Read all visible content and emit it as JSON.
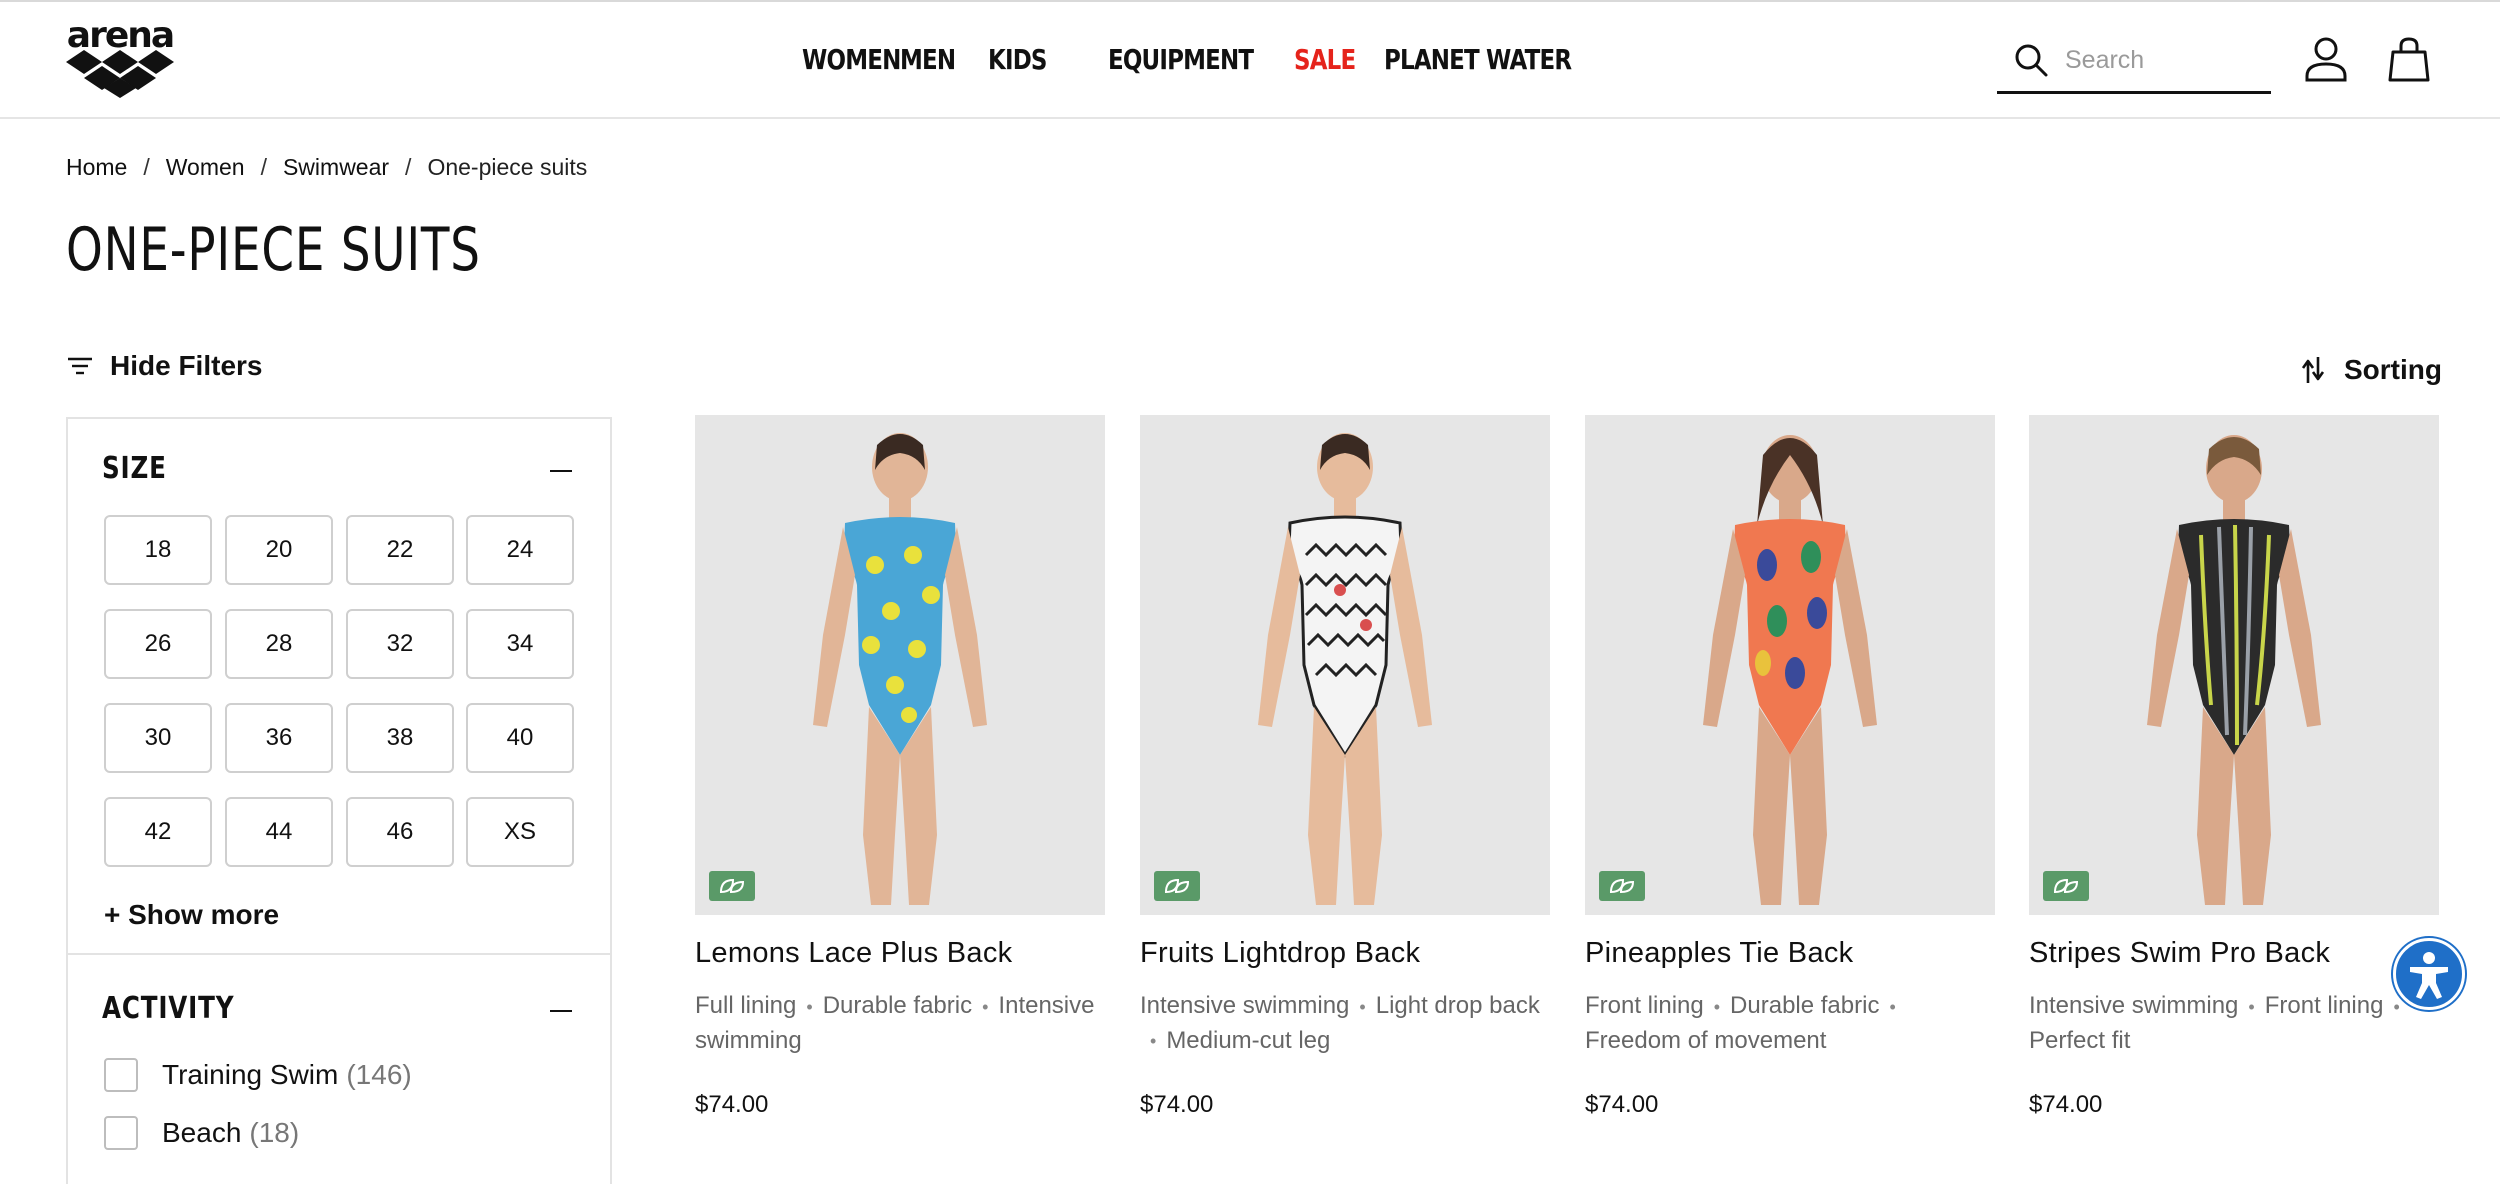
{
  "header": {
    "logo_text": "arena",
    "nav": [
      {
        "label": "WOMEN",
        "highlight": false
      },
      {
        "label": "MEN",
        "highlight": false
      },
      {
        "label": "KIDS",
        "highlight": false
      },
      {
        "label": "EQUIPMENT",
        "highlight": false
      },
      {
        "label": "SALE",
        "highlight": true
      },
      {
        "label": "PLANET WATER",
        "highlight": false
      }
    ],
    "search_placeholder": "Search",
    "search_value": "",
    "icons": {
      "search": "search-icon",
      "account": "user-icon",
      "bag": "shopping-bag-icon"
    }
  },
  "breadcrumb": [
    "Home",
    "Women",
    "Swimwear",
    "One-piece suits"
  ],
  "page_title": "ONE-PIECE SUITS",
  "toolbar": {
    "hide_filters_label": "Hide Filters",
    "sorting_label": "Sorting"
  },
  "filters": {
    "size": {
      "title": "SIZE",
      "options": [
        "18",
        "20",
        "22",
        "24",
        "26",
        "28",
        "32",
        "34",
        "30",
        "36",
        "38",
        "40",
        "42",
        "44",
        "46",
        "XS"
      ],
      "show_more": "+ Show more"
    },
    "activity": {
      "title": "ACTIVITY",
      "options": [
        {
          "label": "Training Swim",
          "count": "(146)"
        },
        {
          "label": "Beach",
          "count": "(18)"
        }
      ]
    }
  },
  "products": [
    {
      "name": "Lemons Lace Plus Back",
      "features": [
        "Full lining",
        "Durable fabric",
        "Intensive swimming"
      ],
      "price": "$74.00",
      "colors": {
        "base": "#4aa6d6",
        "pattern": "#e9e13c",
        "accent": "#3f8f3d"
      }
    },
    {
      "name": "Fruits Lightdrop Back",
      "features": [
        "Intensive swimming",
        "Light drop back",
        "Medium-cut leg"
      ],
      "price": "$74.00",
      "colors": {
        "base": "#f4f4f4",
        "pattern": "#222222",
        "accent": "#d94f4f"
      }
    },
    {
      "name": "Pineapples Tie Back",
      "features": [
        "Front lining",
        "Durable fabric",
        "Freedom of movement"
      ],
      "price": "$74.00",
      "colors": {
        "base": "#f07850",
        "pattern": "#3a4a9a",
        "accent": "#2f8f5a"
      }
    },
    {
      "name": "Stripes Swim Pro Back",
      "features": [
        "Intensive swimming",
        "Front lining",
        "Perfect fit"
      ],
      "price": "$74.00",
      "colors": {
        "base": "#2b2b2b",
        "pattern": "#c8d54a",
        "accent": "#9aa0a8"
      }
    }
  ],
  "colors": {
    "sale": "#e5231b",
    "eco_badge": "#5a9a68",
    "accessibility": "#1f6fc8"
  }
}
